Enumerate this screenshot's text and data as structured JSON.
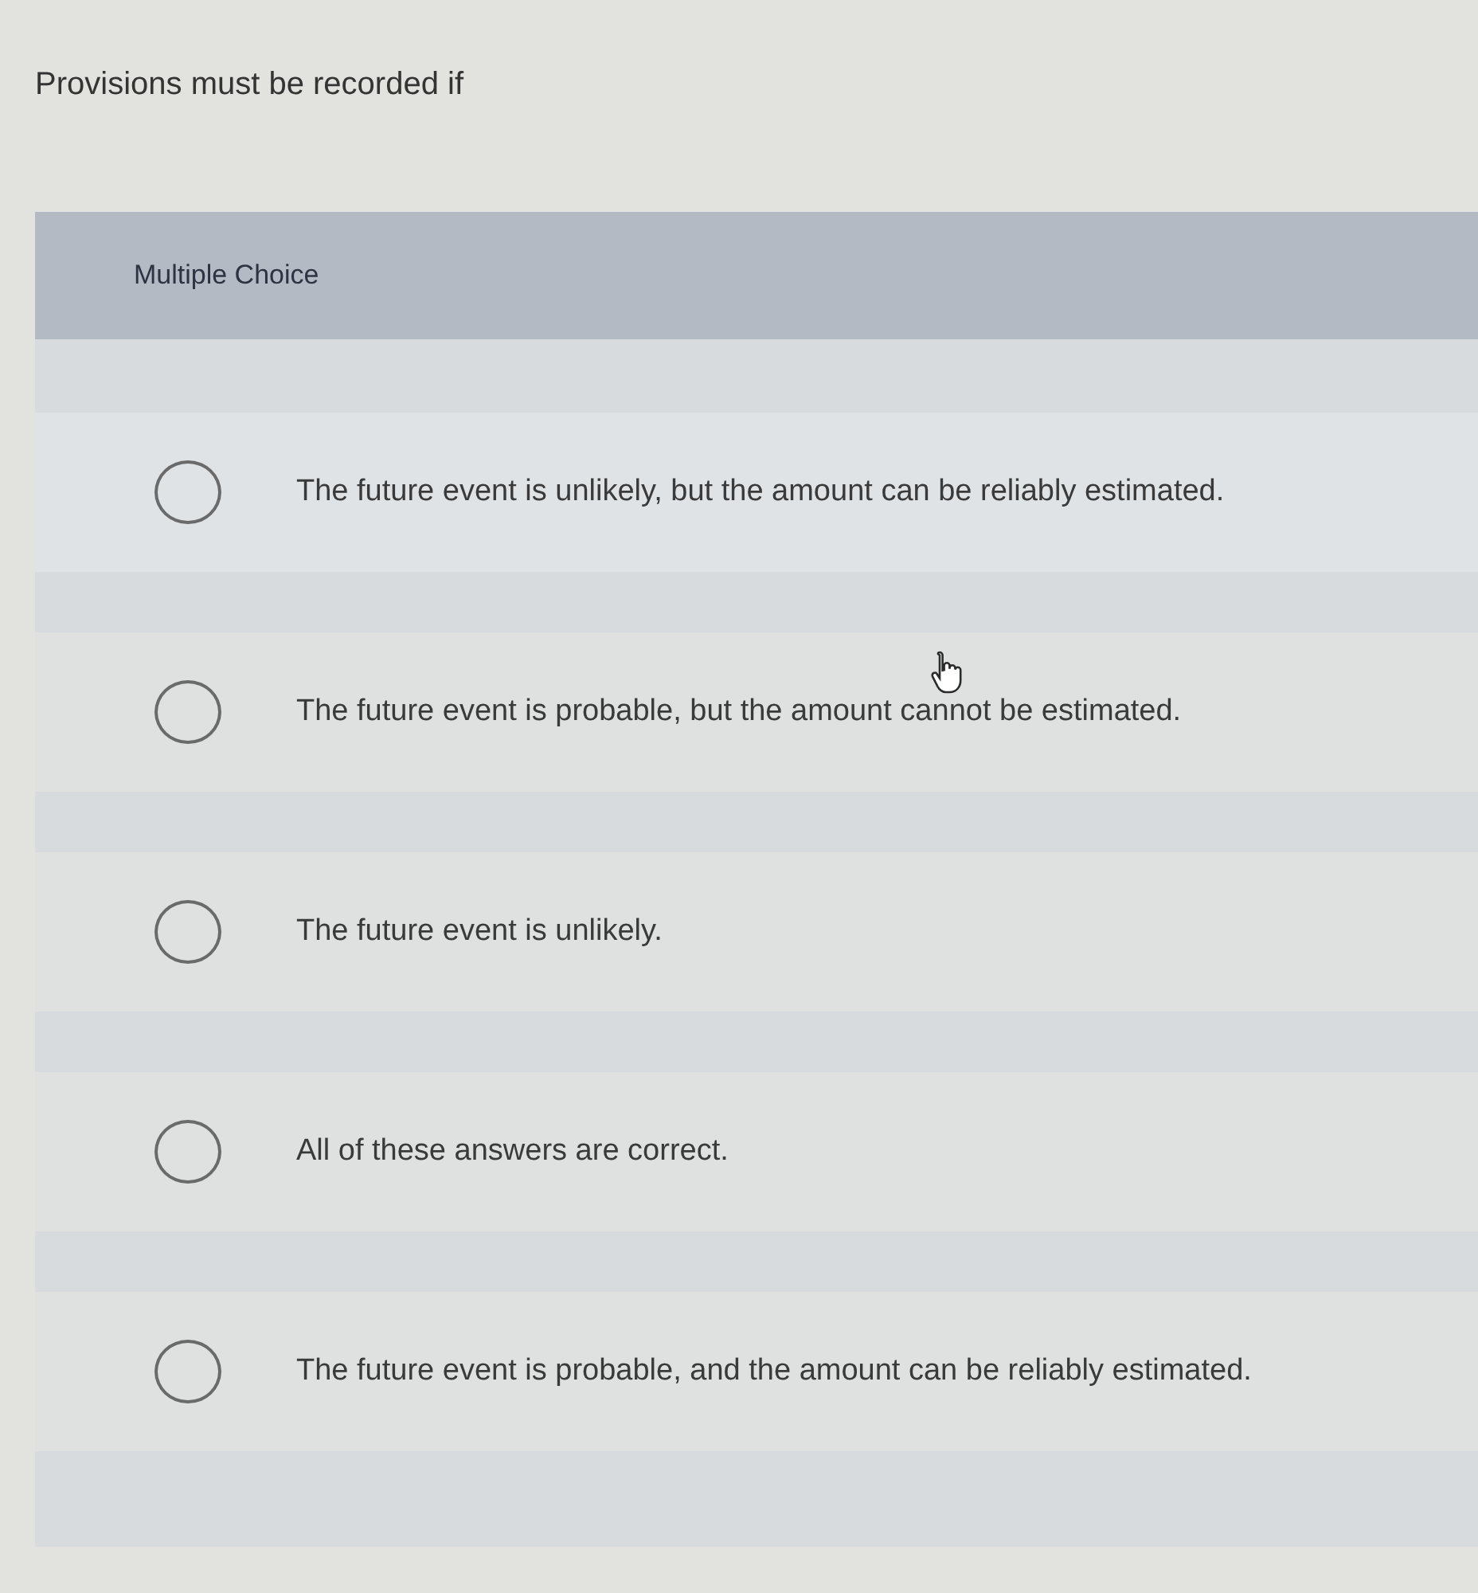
{
  "question": {
    "text": "Provisions must be recorded if"
  },
  "card": {
    "header": "Multiple Choice",
    "options": [
      {
        "text": "The future event is unlikely, but the amount can be reliably estimated.",
        "selected": false
      },
      {
        "text": "The future event is probable, but the amount cannot be estimated.",
        "selected": false
      },
      {
        "text": "The future event is unlikely.",
        "selected": false
      },
      {
        "text": "All of these answers are correct.",
        "selected": false
      },
      {
        "text": "The future event is probable, and the amount can be reliably estimated.",
        "selected": false
      }
    ]
  }
}
